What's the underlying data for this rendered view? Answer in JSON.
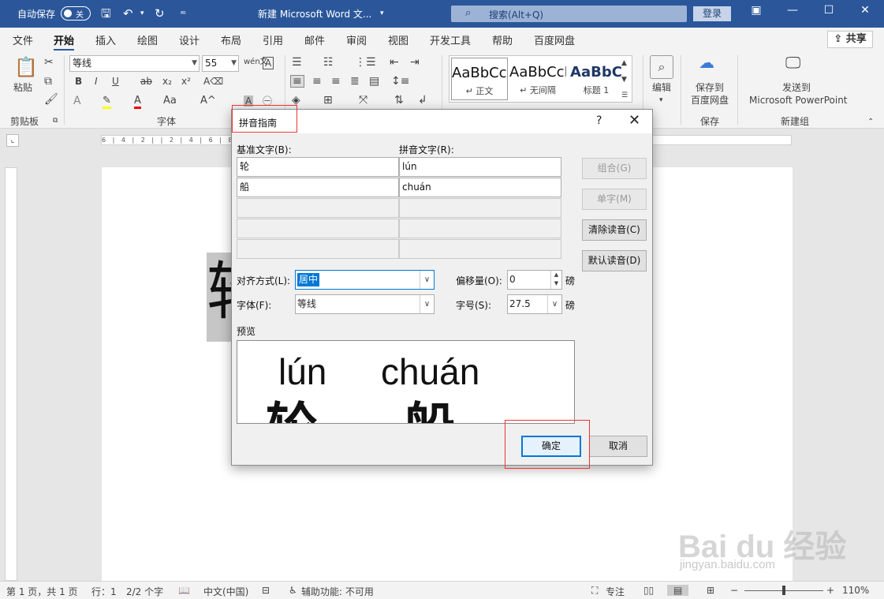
{
  "titlebar": {
    "autosave_label": "自动保存",
    "autosave_state": "关",
    "doc_title": "新建 Microsoft Word 文...",
    "search_placeholder": "搜索(Alt+Q)",
    "login": "登录"
  },
  "tabs": [
    "文件",
    "开始",
    "插入",
    "绘图",
    "设计",
    "布局",
    "引用",
    "邮件",
    "审阅",
    "视图",
    "开发工具",
    "帮助",
    "百度网盘"
  ],
  "share": "共享",
  "ribbon": {
    "paste": "粘贴",
    "clipboard_group": "剪贴板",
    "font_name": "等线",
    "font_size": "55",
    "font_group": "字体",
    "styles": [
      {
        "sample": "AaBbCcI",
        "name": "↵ 正文"
      },
      {
        "sample": "AaBbCcI",
        "name": "↵ 无间隔"
      },
      {
        "sample": "AaBbC",
        "name": "标题 1"
      }
    ],
    "edit": "编辑",
    "save_baidu": "保存到",
    "save_baidu2": "百度网盘",
    "save_group": "保存",
    "send_to": "发送到",
    "send_to2": "Microsoft PowerPoint",
    "new_group": "新建组"
  },
  "ruler_text": "6 | 4 | 2 |   | 2 | 4 | 6 | 8 | 10 | 12 | 14 | 16 | 18 | 20 | 22 | 24 | 26 | 28 | 30 | 32 |",
  "page_char": "轮",
  "dialog": {
    "title": "拼音指南",
    "base_label": "基准文字(B):",
    "ruby_label": "拼音文字(R):",
    "rows": [
      {
        "base": "轮",
        "ruby": "lún"
      },
      {
        "base": "船",
        "ruby": "chuán"
      }
    ],
    "btn_group": "组合(G)",
    "btn_single": "单字(M)",
    "btn_clear": "清除读音(C)",
    "btn_default": "默认读音(D)",
    "align_label": "对齐方式(L):",
    "align_value": "居中",
    "offset_label": "偏移量(O):",
    "offset_value": "0",
    "offset_unit": "磅",
    "font_label": "字体(F):",
    "font_value": "等线",
    "size_label": "字号(S):",
    "size_value": "27.5",
    "size_unit": "磅",
    "preview_label": "预览",
    "preview_py1": "lún",
    "preview_py2": "chuán",
    "preview_ch1": "轮",
    "preview_ch2": "船",
    "ok": "确定",
    "cancel": "取消"
  },
  "statusbar": {
    "page": "第 1 页，共 1 页",
    "line": "行：1",
    "words": "2/2 个字",
    "lang": "中文(中国)",
    "accessibility": "辅助功能: 不可用",
    "focus": "专注",
    "zoom": "110%"
  },
  "watermark": "Bai du 经验",
  "watermark_url": "jingyan.baidu.com"
}
